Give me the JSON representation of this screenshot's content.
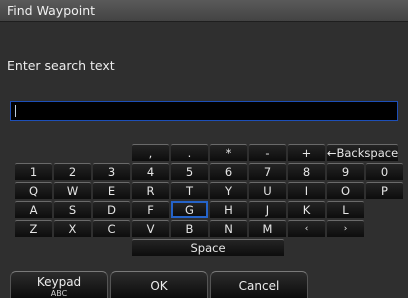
{
  "dialog": {
    "title": "Find Waypoint",
    "prompt": "Enter search text",
    "search_value": ""
  },
  "keyboard": {
    "row0": [
      ",",
      ".",
      "*",
      "-",
      "+",
      "←Backspace"
    ],
    "row1": [
      "1",
      "2",
      "3",
      "4",
      "5",
      "6",
      "7",
      "8",
      "9",
      "0"
    ],
    "row2": [
      "Q",
      "W",
      "E",
      "R",
      "T",
      "Y",
      "U",
      "I",
      "O",
      "P"
    ],
    "row3": [
      "A",
      "S",
      "D",
      "F",
      "G",
      "H",
      "J",
      "K",
      "L"
    ],
    "row4": [
      "Z",
      "X",
      "C",
      "V",
      "B",
      "N",
      "M",
      "‹",
      "›"
    ],
    "space": "Space",
    "selected_key": "G"
  },
  "softkeys": {
    "keypad": "Keypad",
    "keypad_mode": "ABC",
    "ok": "OK",
    "cancel": "Cancel"
  },
  "colors": {
    "selection": "#2563c8",
    "background": "#2f2f2f"
  }
}
